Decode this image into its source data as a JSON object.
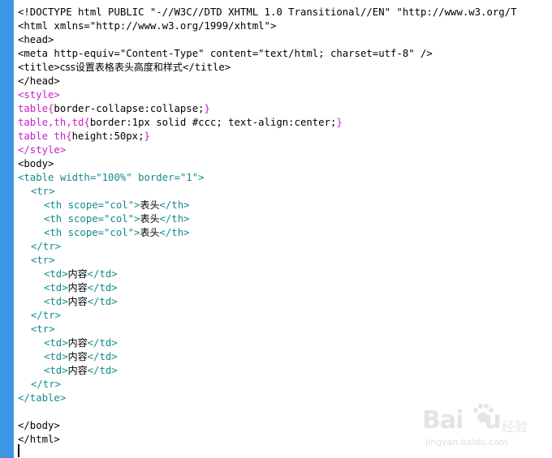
{
  "editor": {
    "lines": [
      {
        "segments": [
          {
            "t": "<!DOCTYPE html PUBLIC \"-//W3C//DTD XHTML 1.0 Transitional//EN\" \"http://www.w3.org/T",
            "c": "black"
          }
        ]
      },
      {
        "segments": [
          {
            "t": "<html xmlns=\"http://www.w3.org/1999/xhtml\">",
            "c": "black"
          }
        ]
      },
      {
        "segments": [
          {
            "t": "<head>",
            "c": "black"
          }
        ]
      },
      {
        "segments": [
          {
            "t": "<meta http-equiv=\"Content-Type\" content=\"text/html; charset=utf-8\" />",
            "c": "black"
          }
        ]
      },
      {
        "segments": [
          {
            "t": "<title>",
            "c": "black"
          },
          {
            "t": "css设置表格表头高度和样式",
            "c": "cjk"
          },
          {
            "t": "</title>",
            "c": "black"
          }
        ]
      },
      {
        "segments": [
          {
            "t": "</head>",
            "c": "black"
          }
        ]
      },
      {
        "segments": [
          {
            "t": "<style>",
            "c": "pink"
          }
        ]
      },
      {
        "segments": [
          {
            "t": "table{",
            "c": "pink"
          },
          {
            "t": "border-collapse:collapse;",
            "c": "black"
          },
          {
            "t": "}",
            "c": "pink"
          }
        ]
      },
      {
        "segments": [
          {
            "t": "table,th,td{",
            "c": "pink"
          },
          {
            "t": "border:1px solid #ccc; text-align:center;",
            "c": "black"
          },
          {
            "t": "}",
            "c": "pink"
          }
        ]
      },
      {
        "segments": [
          {
            "t": "table th{",
            "c": "pink"
          },
          {
            "t": "height:50px;",
            "c": "black"
          },
          {
            "t": "}",
            "c": "pink"
          }
        ]
      },
      {
        "segments": [
          {
            "t": "</style>",
            "c": "pink"
          }
        ]
      },
      {
        "segments": [
          {
            "t": "<body>",
            "c": "black"
          }
        ]
      },
      {
        "segments": [
          {
            "t": "<table width=\"100%\" border=\"1\">",
            "c": "teal"
          }
        ]
      },
      {
        "indent": 1,
        "segments": [
          {
            "t": "<tr>",
            "c": "teal"
          }
        ]
      },
      {
        "indent": 2,
        "segments": [
          {
            "t": "<th scope=\"col\">",
            "c": "teal"
          },
          {
            "t": "表头",
            "c": "cjk"
          },
          {
            "t": "</th>",
            "c": "teal"
          }
        ]
      },
      {
        "indent": 2,
        "segments": [
          {
            "t": "<th scope=\"col\">",
            "c": "teal"
          },
          {
            "t": "表头",
            "c": "cjk"
          },
          {
            "t": "</th>",
            "c": "teal"
          }
        ]
      },
      {
        "indent": 2,
        "segments": [
          {
            "t": "<th scope=\"col\">",
            "c": "teal"
          },
          {
            "t": "表头",
            "c": "cjk"
          },
          {
            "t": "</th>",
            "c": "teal"
          }
        ]
      },
      {
        "indent": 1,
        "segments": [
          {
            "t": "</tr>",
            "c": "teal"
          }
        ]
      },
      {
        "indent": 1,
        "segments": [
          {
            "t": "<tr>",
            "c": "teal"
          }
        ]
      },
      {
        "indent": 2,
        "segments": [
          {
            "t": "<td>",
            "c": "teal"
          },
          {
            "t": "内容",
            "c": "cjk"
          },
          {
            "t": "</td>",
            "c": "teal"
          }
        ]
      },
      {
        "indent": 2,
        "segments": [
          {
            "t": "<td>",
            "c": "teal"
          },
          {
            "t": "内容",
            "c": "cjk"
          },
          {
            "t": "</td>",
            "c": "teal"
          }
        ]
      },
      {
        "indent": 2,
        "segments": [
          {
            "t": "<td>",
            "c": "teal"
          },
          {
            "t": "内容",
            "c": "cjk"
          },
          {
            "t": "</td>",
            "c": "teal"
          }
        ]
      },
      {
        "indent": 1,
        "segments": [
          {
            "t": "</tr>",
            "c": "teal"
          }
        ]
      },
      {
        "indent": 1,
        "segments": [
          {
            "t": "<tr>",
            "c": "teal"
          }
        ]
      },
      {
        "indent": 2,
        "segments": [
          {
            "t": "<td>",
            "c": "teal"
          },
          {
            "t": "内容",
            "c": "cjk"
          },
          {
            "t": "</td>",
            "c": "teal"
          }
        ]
      },
      {
        "indent": 2,
        "segments": [
          {
            "t": "<td>",
            "c": "teal"
          },
          {
            "t": "内容",
            "c": "cjk"
          },
          {
            "t": "</td>",
            "c": "teal"
          }
        ]
      },
      {
        "indent": 2,
        "segments": [
          {
            "t": "<td>",
            "c": "teal"
          },
          {
            "t": "内容",
            "c": "cjk"
          },
          {
            "t": "</td>",
            "c": "teal"
          }
        ]
      },
      {
        "indent": 1,
        "segments": [
          {
            "t": "</tr>",
            "c": "teal"
          }
        ]
      },
      {
        "segments": [
          {
            "t": "</table>",
            "c": "teal"
          }
        ]
      },
      {
        "segments": []
      },
      {
        "segments": [
          {
            "t": "</body>",
            "c": "black"
          }
        ]
      },
      {
        "segments": [
          {
            "t": "</html>",
            "c": "black"
          }
        ]
      }
    ]
  },
  "watermark": {
    "brand": "Bai",
    "brand_suffix": "u",
    "cjk": "经验",
    "site": "jingyan.baidu.com"
  },
  "colors": {
    "gutter": "#3d95e6",
    "tag_black": "#000000",
    "style_pink": "#c71ec9",
    "table_teal": "#138a8c"
  }
}
